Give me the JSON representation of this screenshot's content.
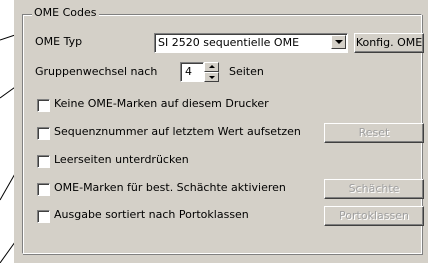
{
  "group": {
    "legend": "OME Codes"
  },
  "ome_typ": {
    "label": "OME Typ",
    "selected": "SI 2520 sequentielle OME",
    "button": "Konfig. OME"
  },
  "gruppenwechsel": {
    "label": "Gruppenwechsel nach",
    "value": "4",
    "suffix": "Seiten"
  },
  "options": [
    {
      "label": "Keine OME-Marken auf diesem Drucker",
      "checked": false
    },
    {
      "label": "Sequenznummer auf letztem Wert aufsetzen",
      "checked": false,
      "button": "Reset"
    },
    {
      "label": "Leerseiten unterdrücken",
      "checked": false
    },
    {
      "label": "OME-Marken für best. Schächte aktivieren",
      "checked": false,
      "button": "Schächte"
    },
    {
      "label": "Ausgabe sortiert nach Portoklassen",
      "checked": false,
      "button": "Portoklassen"
    }
  ]
}
